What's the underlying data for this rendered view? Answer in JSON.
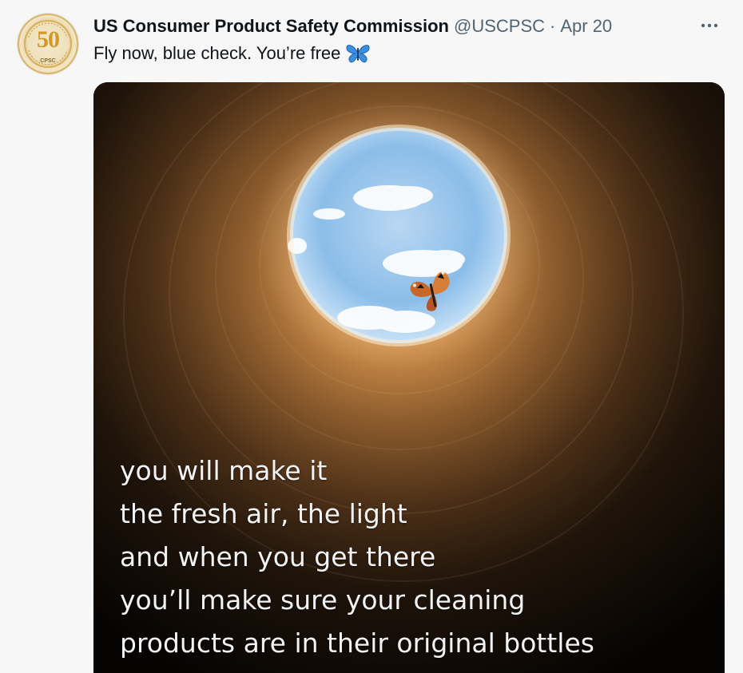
{
  "tweet": {
    "display_name": "US Consumer Product Safety Commission",
    "handle": "@USCPSC",
    "separator": "·",
    "date": "Apr 20",
    "text": "Fly now, blue check. You’re free",
    "more_icon": "ellipsis-icon",
    "emoji_icon": "butterfly-icon"
  },
  "avatar": {
    "badge_number": "50",
    "badge_org": "CPSC",
    "accent_color": "#cf9a2a"
  },
  "media": {
    "caption_lines": [
      "you will make it",
      "the fresh air, the light",
      "and when you get there",
      "you’ll make sure your cleaning",
      "products are in their original bottles"
    ]
  },
  "colors": {
    "background": "#f7f7f7",
    "text_primary": "#0f1419",
    "text_secondary": "#536471",
    "butterfly_emoji": "#3b8fe0"
  }
}
